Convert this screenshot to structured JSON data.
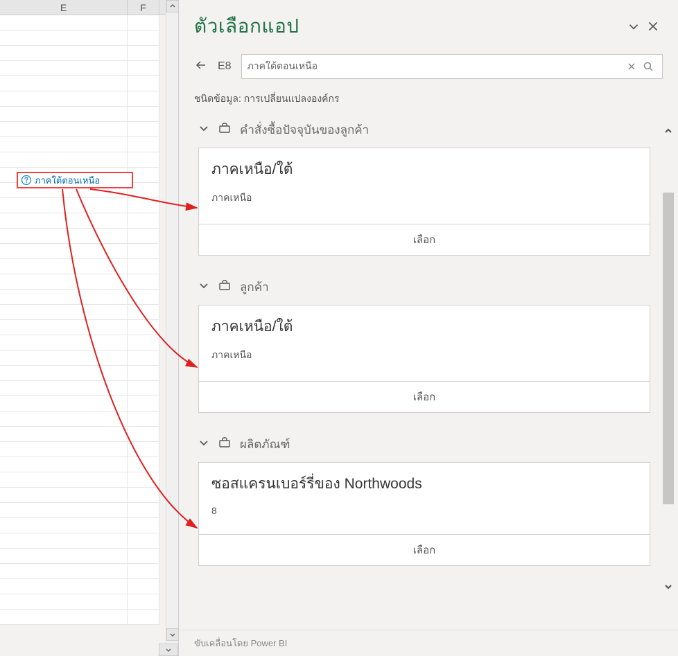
{
  "sheet": {
    "columns": [
      "E",
      "F"
    ],
    "selected_cell_text": "ภาคใต้ตอนเหนือ"
  },
  "pane": {
    "title": "ตัวเลือกแอป",
    "cell_ref": "E8",
    "search_value": "ภาคใต้ตอนเหนือ",
    "datatype_label": "ชนิดข้อมูล:",
    "datatype_value": "การเปลี่ยนแปลงองค์กร",
    "groups": [
      {
        "header": "คำสั่งซื้อปัจจุบันของลูกค้า",
        "card_title": "ภาคเหนือ/ใต้",
        "card_sub": "ภาคเหนือ",
        "select_label": "เลือก"
      },
      {
        "header": "ลูกค้า",
        "card_title": "ภาคเหนือ/ใต้",
        "card_sub": "ภาคเหนือ",
        "select_label": "เลือก"
      },
      {
        "header": "ผลิตภัณฑ์",
        "card_title": "ซอสแครนเบอร์รี่ของ Northwoods",
        "card_sub": "8",
        "select_label": "เลือก"
      }
    ],
    "footer": "ขับเคลื่อนโดย Power BI"
  }
}
